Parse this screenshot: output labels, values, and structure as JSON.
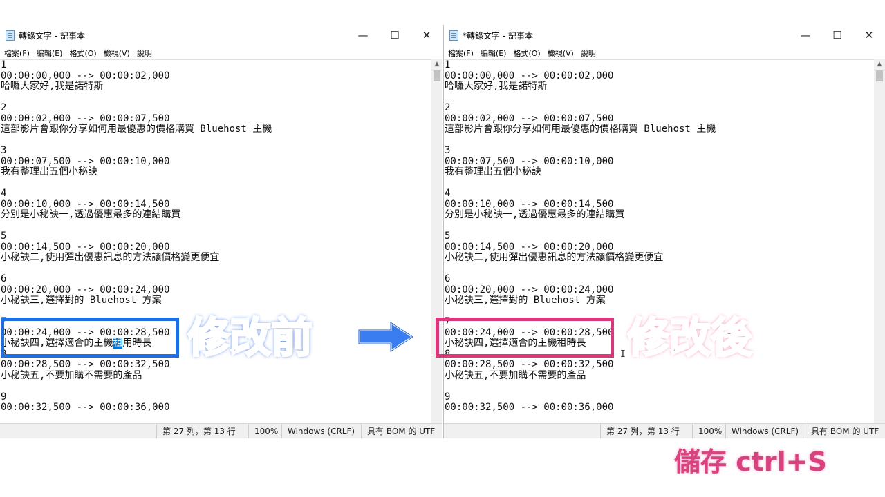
{
  "windows": {
    "left": {
      "title": "轉錄文字 - 記事本",
      "controls": {
        "min": "—",
        "max": "☐",
        "close": "✕"
      },
      "menu": [
        "檔案(F)",
        "編輯(E)",
        "格式(O)",
        "檢視(V)",
        "說明"
      ],
      "status": {
        "position": "第 27 列，第 13 行",
        "zoom": "100%",
        "eol": "Windows (CRLF)",
        "encoding": "具有 BOM 的 UTF"
      },
      "edited_line": {
        "before": "小秘訣四,選擇適合的主機",
        "highlight": "租",
        "after": "用時長"
      }
    },
    "right": {
      "title": "*轉錄文字 - 記事本",
      "controls": {
        "min": "—",
        "max": "☐",
        "close": "✕"
      },
      "menu": [
        "檔案(F)",
        "編輯(E)",
        "格式(O)",
        "檢視(V)",
        "說明"
      ],
      "status": {
        "position": "第 27 列，第 13 行",
        "zoom": "100%",
        "eol": "Windows (CRLF)",
        "encoding": "具有 BOM 的 UTF"
      },
      "edited_line": {
        "before": "小秘訣四,選擇適合的主機",
        "highlight": "",
        "after": "租時長"
      }
    }
  },
  "lines_top": [
    "1",
    "00:00:00,000 --> 00:00:02,000",
    "哈囉大家好,我是諾特斯",
    "",
    "2",
    "00:00:02,000 --> 00:00:07,500",
    "這部影片會跟你分享如何用最優惠的價格購買 Bluehost 主機",
    "",
    "3",
    "00:00:07,500 --> 00:00:10,000",
    "我有整理出五個小秘訣",
    "",
    "4",
    "00:00:10,000 --> 00:00:14,500",
    "分別是小秘訣一,透過優惠最多的連結購買",
    "",
    "5",
    "00:00:14,500 --> 00:00:20,000",
    "小秘訣二,使用彈出優惠訊息的方法讓價格變更便宜",
    "",
    "6",
    "00:00:20,000 --> 00:00:24,000",
    "小秘訣三,選擇對的 Bluehost 方案",
    "",
    "7",
    "00:00:24,000 --> 00:00:28,500"
  ],
  "lines_bottom": [
    "8",
    "00:00:28,500 --> 00:00:32,500",
    "小秘訣五,不要加購不需要的產品",
    "",
    "9",
    "00:00:32,500 --> 00:00:36,000"
  ],
  "scroll_arrows": {
    "up": "▲",
    "down": "▼",
    "left": "<",
    "right": ">"
  },
  "overlay": {
    "before_label": "修改前",
    "after_label": "修改後",
    "save_label": "儲存 ctrl+S",
    "cursor": "I"
  },
  "colors": {
    "before": "#1f6fe0",
    "after": "#d9397a",
    "selection": "#0078d7"
  }
}
